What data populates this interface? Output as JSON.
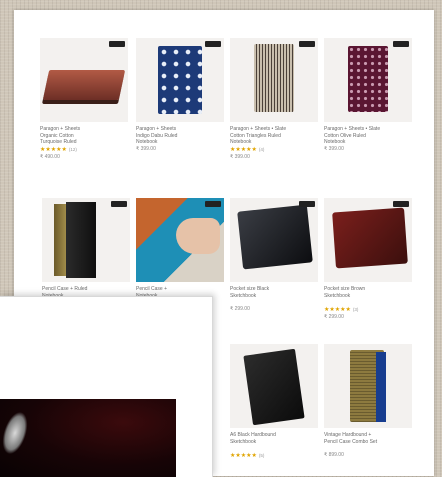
{
  "products": [
    {
      "title": "Paragon + Sheets\nOrganic Cotton\nTurquoise Ruled\nNotebook",
      "rating": "★★★★★",
      "count": "(12)",
      "price": "₹ 490.00",
      "art": "notebook-red"
    },
    {
      "title": "Paragon + Sheets\nIndigo Dabu Ruled\nNotebook",
      "rating": "",
      "count": "",
      "price": "₹ 399.00",
      "art": "notebook-blue"
    },
    {
      "title": "Paragon + Sheets • Slate\nCotton Triangles Ruled\nNotebook",
      "rating": "★★★★★",
      "count": "(4)",
      "price": "₹ 399.00",
      "art": "notebook-stripe"
    },
    {
      "title": "Paragon + Sheets • Slate\nCotton Olive Ruled\nNotebook",
      "rating": "",
      "count": "",
      "price": "₹ 399.00",
      "art": "notebook-maroon"
    },
    {
      "title": "Pencil Case + Ruled\nNotebook",
      "rating": "",
      "count": "",
      "price": "",
      "art": "notebook-black-brass"
    },
    {
      "title": "Pencil Case +\nNotebook",
      "rating": "",
      "count": "",
      "price": "",
      "art": "pencil-case-hand"
    },
    {
      "title": "Pocket size Black\nSketchbook",
      "rating": "",
      "count": "",
      "price": "₹ 299.00",
      "art": "notebook-black"
    },
    {
      "title": "Pocket size Brown\nSketchbook",
      "rating": "★★★★★",
      "count": "(3)",
      "price": "₹ 299.00",
      "art": "notebook-brown"
    },
    {
      "title": "A6 Black Hardbound\nSketchbook",
      "rating": "★★★★★",
      "count": "(5)",
      "price": "",
      "art": "notebook-black-small"
    },
    {
      "title": "Vintage Hardbound +\nPencil Case Combo Set",
      "rating": "",
      "count": "",
      "price": "₹ 899.00",
      "art": "notebook-gold"
    }
  ],
  "colors": {
    "background": "#cfc6b8",
    "page": "#ffffff",
    "star": "#e0a400",
    "text": "#6a6a6a"
  }
}
